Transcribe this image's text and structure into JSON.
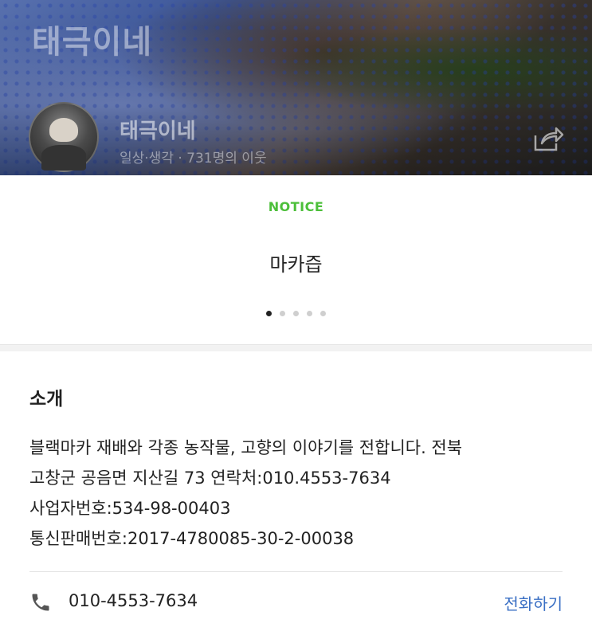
{
  "cover": {
    "title": "태극이네",
    "blog_name": "태극이네",
    "meta": "일상·생각 · 731명의 이웃"
  },
  "notice": {
    "tag": "NOTICE",
    "title": "마카즙",
    "page_count": 5,
    "active_index": 0
  },
  "intro": {
    "heading": "소개",
    "lines": [
      "블랙마카 재배와 각종 농작물, 고향의 이야기를 전합니다. 전북",
      "고창군 공음면 지산길 73  연락처:010.4553-7634",
      "사업자번호:534-98-00403",
      "통신판매번호:2017-4780085-30-2-00038"
    ]
  },
  "contact": {
    "phone": "010-4553-7634",
    "call_label": "전화하기"
  },
  "icons": {
    "share": "share-icon",
    "phone": "phone-icon"
  },
  "colors": {
    "notice_green": "#4cbf3a",
    "call_blue": "#3a6fc4"
  }
}
